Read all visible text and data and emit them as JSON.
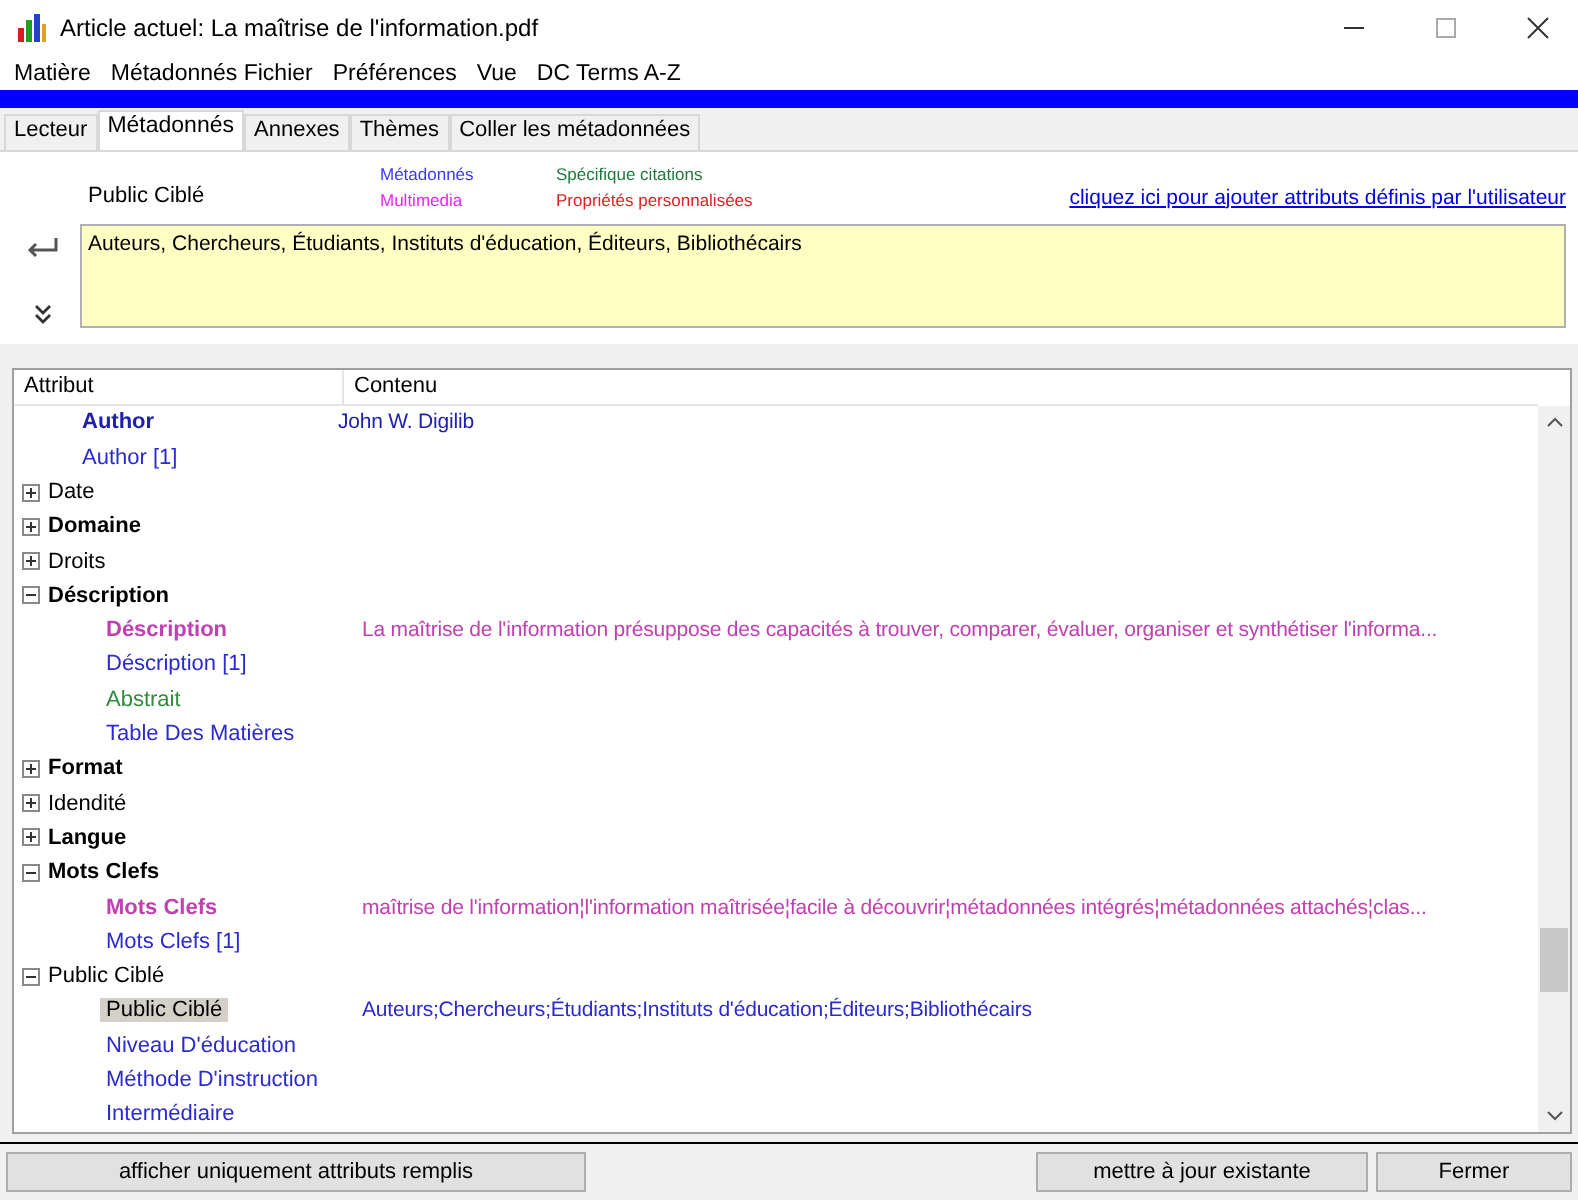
{
  "window": {
    "title": "Article actuel: La maîtrise de l'information.pdf"
  },
  "menu": [
    "Matière",
    "Métadonnés Fichier",
    "Préférences",
    "Vue",
    "DC Terms A-Z"
  ],
  "tabs": [
    {
      "label": "Lecteur",
      "selected": false
    },
    {
      "label": "Métadonnés",
      "selected": true
    },
    {
      "label": "Annexes",
      "selected": false
    },
    {
      "label": "Thèmes",
      "selected": false
    },
    {
      "label": "Coller les métadonnées",
      "selected": false
    }
  ],
  "editor": {
    "attribute_label": "Public Ciblé",
    "legend": [
      {
        "label": "Métadonnés",
        "color": "#3a3aff"
      },
      {
        "label": "Spécifique citations",
        "color": "#1e7a3c"
      },
      {
        "label": "Multimedia",
        "color": "#ee22ee"
      },
      {
        "label": "Propriétés personnalisées",
        "color": "#e02020"
      }
    ],
    "link": "cliquez ici pour ajouter attributs définis par l'utilisateur",
    "value": "Auteurs, Chercheurs, Étudiants, Instituts d'éducation, Éditeurs, Bibliothécairs"
  },
  "tree": {
    "columns": [
      "Attribut",
      "Contenu"
    ],
    "items": [
      {
        "kind": "attribute",
        "label": "Author",
        "bold": true,
        "color": "#2020b0",
        "value": "John W. Digilib",
        "selected": false
      },
      {
        "kind": "attribute",
        "label": "Author [1]",
        "bold": false,
        "color": "#2a2ad0",
        "selected": false
      },
      {
        "kind": "group",
        "label": "Date",
        "bold": false,
        "expanded": false
      },
      {
        "kind": "group",
        "label": "Domaine",
        "bold": true,
        "expanded": false
      },
      {
        "kind": "group",
        "label": "Droits",
        "bold": false,
        "expanded": false
      },
      {
        "kind": "group",
        "label": "Déscription",
        "bold": true,
        "expanded": true,
        "children": [
          {
            "kind": "attribute",
            "label": "Déscription",
            "bold": true,
            "color": "#c040b0",
            "value": "La maîtrise de l'information présuppose des capacités à trouver, comparer, évaluer, organiser et synthétiser l'informa...",
            "selected": false
          },
          {
            "kind": "attribute",
            "label": "Déscription [1]",
            "bold": false,
            "color": "#2a2ad0",
            "selected": false
          },
          {
            "kind": "attribute",
            "label": "Abstrait",
            "bold": false,
            "color": "#2e8b3c",
            "selected": false
          },
          {
            "kind": "attribute",
            "label": "Table Des Matières",
            "bold": false,
            "color": "#2a2ad0",
            "selected": false
          }
        ]
      },
      {
        "kind": "group",
        "label": "Format",
        "bold": true,
        "expanded": false
      },
      {
        "kind": "group",
        "label": "Idendité",
        "bold": false,
        "expanded": false
      },
      {
        "kind": "group",
        "label": "Langue",
        "bold": true,
        "expanded": false
      },
      {
        "kind": "group",
        "label": "Mots Clefs",
        "bold": true,
        "expanded": true,
        "children": [
          {
            "kind": "attribute",
            "label": "Mots Clefs",
            "bold": true,
            "color": "#c040b0",
            "value": "maîtrise de l'information¦l'information maîtrisée¦facile à découvrir¦métadonnées intégrés¦métadonnées attachés¦clas...",
            "selected": false
          },
          {
            "kind": "attribute",
            "label": "Mots Clefs [1]",
            "bold": false,
            "color": "#2a2ad0",
            "selected": false
          }
        ]
      },
      {
        "kind": "group",
        "label": "Public Ciblé",
        "bold": false,
        "expanded": true,
        "children": [
          {
            "kind": "attribute",
            "label": "Public Ciblé",
            "bold": false,
            "color": "#2a2ad0",
            "value": "Auteurs;Chercheurs;Étudiants;Instituts d'éducation;Éditeurs;Bibliothécairs",
            "selected": true
          },
          {
            "kind": "attribute",
            "label": "Niveau D'éducation",
            "bold": false,
            "color": "#2a2ad0",
            "selected": false
          },
          {
            "kind": "attribute",
            "label": "Méthode D'instruction",
            "bold": false,
            "color": "#2a2ad0",
            "selected": false
          },
          {
            "kind": "attribute",
            "label": "Intermédiaire",
            "bold": false,
            "color": "#2a2ad0",
            "selected": false
          }
        ]
      }
    ]
  },
  "buttons": {
    "left": [
      "afficher uniquement attributs remplis"
    ],
    "right": [
      "mettre à jour existante",
      "Fermer"
    ]
  }
}
